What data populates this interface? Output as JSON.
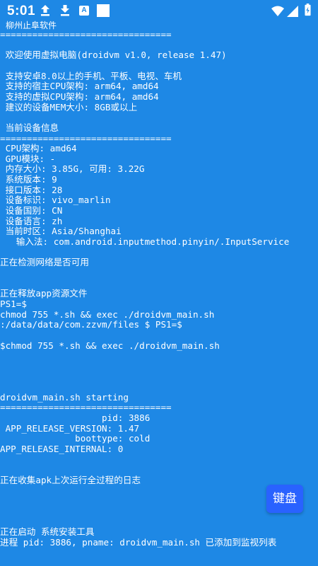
{
  "status_bar": {
    "time": "5:01",
    "notification_icons": [
      "upload-icon",
      "download-icon",
      "app-a-icon",
      "square-icon"
    ],
    "system_icons": [
      "wifi-icon",
      "signal-icon",
      "battery-icon"
    ]
  },
  "app": {
    "name": "柳州止阜软件"
  },
  "console": {
    "lines": [
      "================================",
      "",
      " 欢迎使用虚拟电脑(droidvm v1.0, release 1.47)",
      "",
      " 支持安卓8.0以上的手机、平板、电视、车机",
      " 支持的宿主CPU架构: arm64, amd64",
      " 支持的虚拟CPU架构: arm64, amd64",
      " 建议的设备MEM大小: 8GB或以上",
      "",
      " 当前设备信息",
      "================================",
      " CPU架构: amd64",
      " GPU模块: -",
      " 内存大小: 3.85G, 可用: 3.22G",
      " 系统版本: 9",
      " 接口版本: 28",
      " 设备标识: vivo_marlin",
      " 设备国别: CN",
      " 设备语言: zh",
      " 当前时区: Asia/Shanghai",
      "   输入法: com.android.inputmethod.pinyin/.InputService",
      "",
      "正在检测网络是否可用",
      "",
      "",
      "正在释放app资源文件",
      "PS1=$",
      "chmod 755 *.sh && exec ./droidvm_main.sh",
      ":/data/data/com.zzvm/files $ PS1=$",
      "",
      "$chmod 755 *.sh && exec ./droidvm_main.sh",
      "",
      "",
      "",
      "",
      "droidvm_main.sh starting",
      "================================",
      "                   pid: 3886",
      " APP_RELEASE_VERSION: 1.47",
      "              boottype: cold",
      "APP_RELEASE_INTERNAL: 0",
      "",
      "",
      "正在收集apk上次运行全过程的日志",
      "",
      "",
      "",
      "",
      "正在启动 系统安装工具",
      "进程 pid: 3886, pname: droidvm_main.sh 已添加到监视列表"
    ]
  },
  "keyboard_button": {
    "label": "键盘"
  }
}
